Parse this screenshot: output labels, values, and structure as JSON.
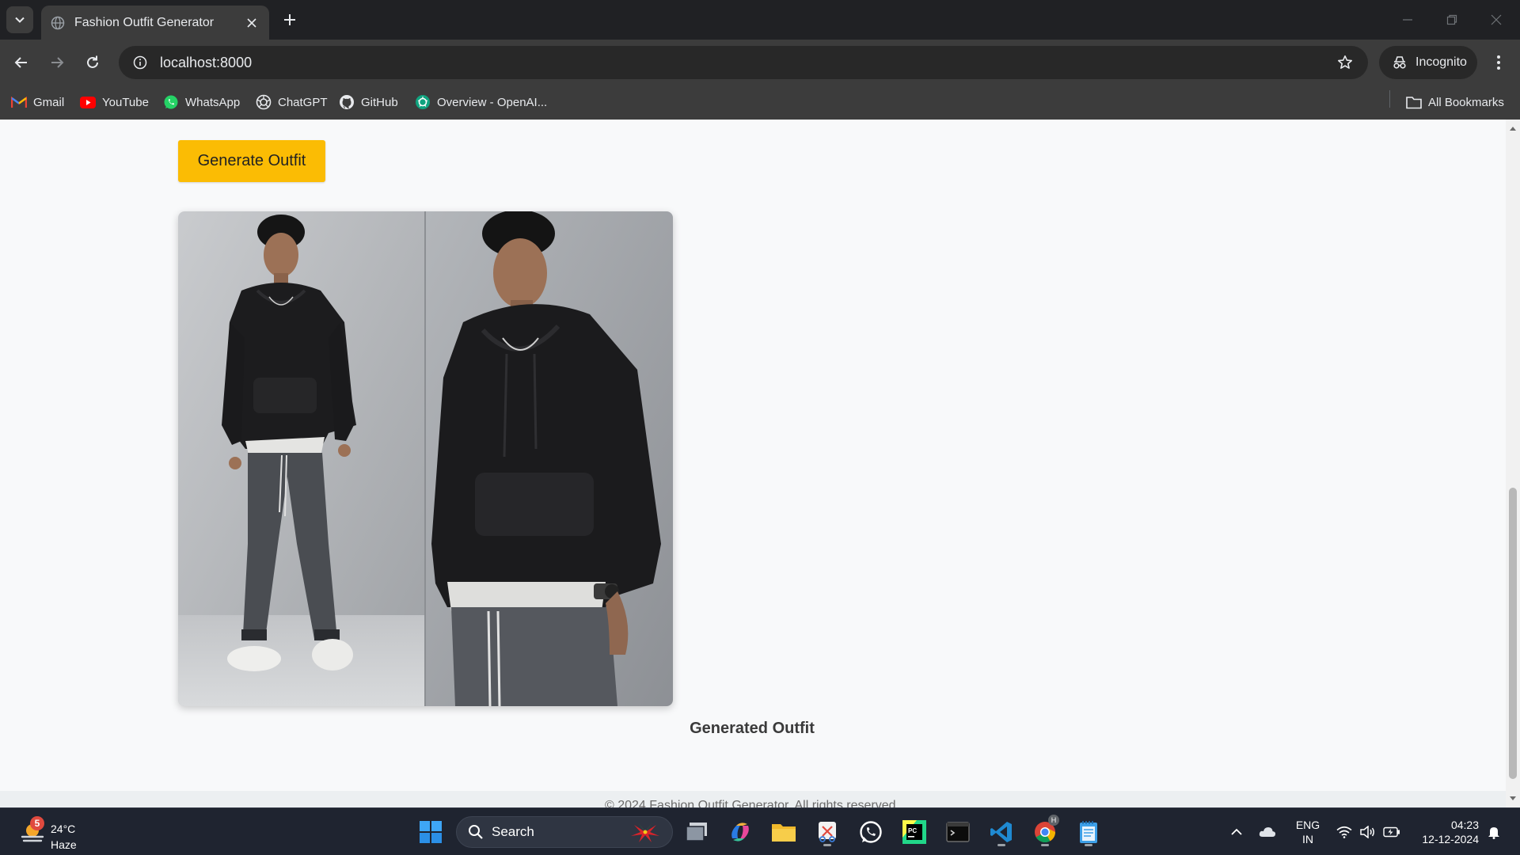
{
  "browser": {
    "tab": {
      "title": "Fashion Outfit Generator"
    },
    "url": "localhost:8000",
    "incognito_label": "Incognito",
    "bookmarks": [
      {
        "label": "Gmail",
        "icon": "gmail-icon"
      },
      {
        "label": "YouTube",
        "icon": "youtube-icon"
      },
      {
        "label": "WhatsApp",
        "icon": "whatsapp-icon"
      },
      {
        "label": "ChatGPT",
        "icon": "chatgpt-icon"
      },
      {
        "label": "GitHub",
        "icon": "github-icon"
      },
      {
        "label": "Overview - OpenAI...",
        "icon": "openai-icon"
      }
    ],
    "all_bookmarks_label": "All Bookmarks"
  },
  "page": {
    "generate_button": "Generate Outfit",
    "image_caption": "Generated Outfit",
    "footer_text": "© 2024 Fashion Outfit Generator. All rights reserved.",
    "accent_color": "#fbbc04"
  },
  "taskbar": {
    "weather": {
      "badge": "5",
      "temp": "24°C",
      "condition": "Haze"
    },
    "search_label": "Search",
    "lang_line1": "ENG",
    "lang_line2": "IN",
    "time": "04:23",
    "date": "12-12-2024",
    "chrome_badge": "H"
  }
}
